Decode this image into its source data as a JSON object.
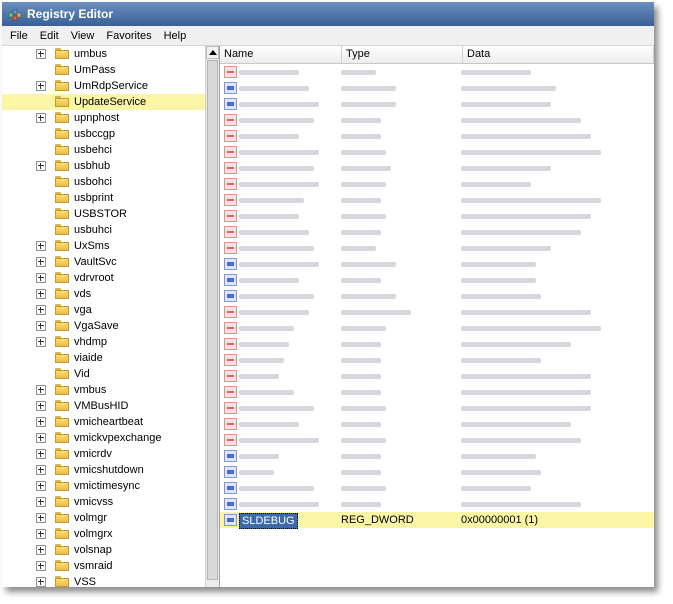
{
  "window": {
    "title": "Registry Editor"
  },
  "menu": [
    "File",
    "Edit",
    "View",
    "Favorites",
    "Help"
  ],
  "tree": {
    "items": [
      {
        "label": "umbus",
        "expandable": true
      },
      {
        "label": "UmPass",
        "expandable": false
      },
      {
        "label": "UmRdpService",
        "expandable": true
      },
      {
        "label": "UpdateService",
        "expandable": false,
        "selected": true
      },
      {
        "label": "upnphost",
        "expandable": true
      },
      {
        "label": "usbccgp",
        "expandable": false
      },
      {
        "label": "usbehci",
        "expandable": false
      },
      {
        "label": "usbhub",
        "expandable": true
      },
      {
        "label": "usbohci",
        "expandable": false
      },
      {
        "label": "usbprint",
        "expandable": false
      },
      {
        "label": "USBSTOR",
        "expandable": false
      },
      {
        "label": "usbuhci",
        "expandable": false
      },
      {
        "label": "UxSms",
        "expandable": true
      },
      {
        "label": "VaultSvc",
        "expandable": true
      },
      {
        "label": "vdrvroot",
        "expandable": true
      },
      {
        "label": "vds",
        "expandable": true
      },
      {
        "label": "vga",
        "expandable": true
      },
      {
        "label": "VgaSave",
        "expandable": true
      },
      {
        "label": "vhdmp",
        "expandable": true
      },
      {
        "label": "viaide",
        "expandable": false
      },
      {
        "label": "Vid",
        "expandable": false
      },
      {
        "label": "vmbus",
        "expandable": true
      },
      {
        "label": "VMBusHID",
        "expandable": true
      },
      {
        "label": "vmicheartbeat",
        "expandable": true
      },
      {
        "label": "vmickvpexchange",
        "expandable": true
      },
      {
        "label": "vmicrdv",
        "expandable": true
      },
      {
        "label": "vmicshutdown",
        "expandable": true
      },
      {
        "label": "vmictimesync",
        "expandable": true
      },
      {
        "label": "vmicvss",
        "expandable": true
      },
      {
        "label": "volmgr",
        "expandable": true
      },
      {
        "label": "volmgrx",
        "expandable": true
      },
      {
        "label": "volsnap",
        "expandable": true
      },
      {
        "label": "vsmraid",
        "expandable": true
      },
      {
        "label": "VSS",
        "expandable": true
      }
    ]
  },
  "list": {
    "columns": {
      "name": "Name",
      "type": "Type",
      "data": "Data"
    },
    "blurred_icons": [
      "str",
      "bin",
      "bin",
      "str",
      "str",
      "str",
      "str",
      "str",
      "str",
      "str",
      "str",
      "str",
      "bin",
      "bin",
      "bin",
      "str",
      "str",
      "str",
      "str",
      "str",
      "str",
      "str",
      "str",
      "str",
      "bin",
      "bin",
      "bin",
      "bin"
    ],
    "selected_value": {
      "name": "SLDEBUG",
      "type": "REG_DWORD",
      "data": "0x00000001 (1)"
    }
  }
}
